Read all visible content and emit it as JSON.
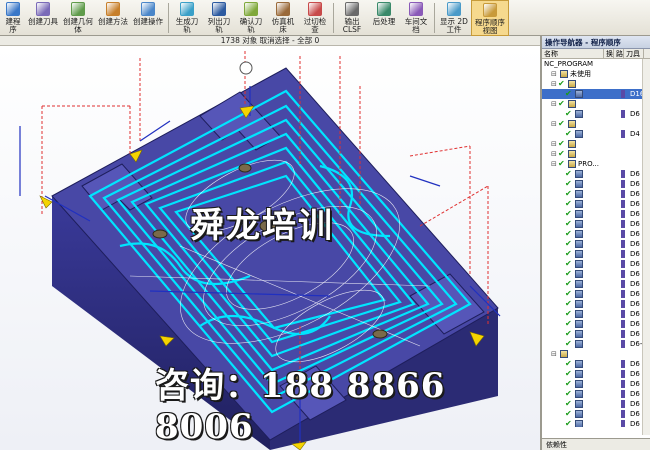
{
  "toolbar": {
    "items": [
      {
        "label": "建程序",
        "icon": "create-program-icon",
        "color": "#3a78c8"
      },
      {
        "label": "创建刀具",
        "icon": "create-tool-icon",
        "color": "#7a6ab8"
      },
      {
        "label": "创建几何体",
        "icon": "create-geometry-icon",
        "color": "#5f9b4a"
      },
      {
        "label": "创建方法",
        "icon": "create-method-icon",
        "color": "#c77f2a"
      },
      {
        "label": "创建操作",
        "icon": "create-operation-icon",
        "color": "#4a86c9"
      },
      {
        "label": "生成刀轨",
        "icon": "generate-toolpath-icon",
        "color": "#3aa0c8"
      },
      {
        "label": "列出刀轨",
        "icon": "list-toolpath-icon",
        "color": "#2c5aa0"
      },
      {
        "label": "确认刀轨",
        "icon": "verify-toolpath-icon",
        "color": "#7fa83a"
      },
      {
        "label": "仿真机床",
        "icon": "simulate-machine-icon",
        "color": "#9a6a3a"
      },
      {
        "label": "过切检查",
        "icon": "gouge-check-icon",
        "color": "#c84a4a"
      },
      {
        "label": "输出CLSF",
        "icon": "output-clsf-icon",
        "color": "#6a6a6a"
      },
      {
        "label": "后处理",
        "icon": "postprocess-icon",
        "color": "#3a8a6a"
      },
      {
        "label": "车间文档",
        "icon": "shop-doc-icon",
        "color": "#8a5ab8"
      },
      {
        "label": "显示 2D工件",
        "icon": "show-2d-workpiece-icon",
        "color": "#4a9ac8"
      },
      {
        "label": "程序顺序视图",
        "icon": "program-order-view-icon",
        "color": "#c89a3a"
      }
    ]
  },
  "status": {
    "text": "1738 对象 取消选择 - 全部 0"
  },
  "watermark": {
    "title": "舜龙培训",
    "contact": "咨询：188 8866 8006"
  },
  "navigator": {
    "title": "操作导航器 - 程序顺序",
    "columns": [
      "名称",
      "换",
      "路",
      "刀具"
    ],
    "rows": [
      {
        "text": "NC_PROGRAM",
        "indent": 0,
        "check": false,
        "type": "text",
        "tool": ""
      },
      {
        "text": "未使用",
        "indent": 1,
        "check": false,
        "type": "folder",
        "tool": ""
      },
      {
        "text": "",
        "indent": 1,
        "check": true,
        "type": "folder",
        "tool": ""
      },
      {
        "text": "",
        "indent": 2,
        "check": true,
        "type": "op",
        "tool": "D16R0.8",
        "selected": true
      },
      {
        "text": "",
        "indent": 1,
        "check": true,
        "type": "folder",
        "tool": ""
      },
      {
        "text": "",
        "indent": 2,
        "check": true,
        "type": "op",
        "tool": "D6"
      },
      {
        "text": "",
        "indent": 1,
        "check": true,
        "type": "folder",
        "tool": ""
      },
      {
        "text": "",
        "indent": 2,
        "check": true,
        "type": "op",
        "tool": "D4"
      },
      {
        "text": "",
        "indent": 1,
        "check": true,
        "type": "folder",
        "tool": ""
      },
      {
        "text": "",
        "indent": 1,
        "check": true,
        "type": "folder",
        "tool": ""
      },
      {
        "text": "PRO...",
        "indent": 1,
        "check": true,
        "type": "folder",
        "tool": ""
      },
      {
        "text": "",
        "indent": 2,
        "check": true,
        "type": "op",
        "tool": "D6"
      },
      {
        "text": "",
        "indent": 2,
        "check": true,
        "type": "op",
        "tool": "D6"
      },
      {
        "text": "",
        "indent": 2,
        "check": true,
        "type": "op",
        "tool": "D6"
      },
      {
        "text": "",
        "indent": 2,
        "check": true,
        "type": "op",
        "tool": "D6"
      },
      {
        "text": "",
        "indent": 2,
        "check": true,
        "type": "op",
        "tool": "D6"
      },
      {
        "text": "",
        "indent": 2,
        "check": true,
        "type": "op",
        "tool": "D6"
      },
      {
        "text": "",
        "indent": 2,
        "check": true,
        "type": "op",
        "tool": "D6"
      },
      {
        "text": "",
        "indent": 2,
        "check": true,
        "type": "op",
        "tool": "D6"
      },
      {
        "text": "",
        "indent": 2,
        "check": true,
        "type": "op",
        "tool": "D6"
      },
      {
        "text": "",
        "indent": 2,
        "check": true,
        "type": "op",
        "tool": "D6"
      },
      {
        "text": "",
        "indent": 2,
        "check": true,
        "type": "op",
        "tool": "D6"
      },
      {
        "text": "",
        "indent": 2,
        "check": true,
        "type": "op",
        "tool": "D6"
      },
      {
        "text": "",
        "indent": 2,
        "check": true,
        "type": "op",
        "tool": "D6"
      },
      {
        "text": "",
        "indent": 2,
        "check": true,
        "type": "op",
        "tool": "D6"
      },
      {
        "text": "",
        "indent": 2,
        "check": true,
        "type": "op",
        "tool": "D6"
      },
      {
        "text": "",
        "indent": 2,
        "check": true,
        "type": "op",
        "tool": "D6"
      },
      {
        "text": "",
        "indent": 2,
        "check": true,
        "type": "op",
        "tool": "D6"
      },
      {
        "text": "",
        "indent": 2,
        "check": true,
        "type": "op",
        "tool": "D6-0.1"
      },
      {
        "text": "",
        "indent": 1,
        "check": false,
        "type": "folder",
        "tool": ""
      },
      {
        "text": "",
        "indent": 2,
        "check": true,
        "type": "op",
        "tool": "D6"
      },
      {
        "text": "",
        "indent": 2,
        "check": true,
        "type": "op",
        "tool": "D6"
      },
      {
        "text": "",
        "indent": 2,
        "check": true,
        "type": "op",
        "tool": "D6"
      },
      {
        "text": "",
        "indent": 2,
        "check": true,
        "type": "op",
        "tool": "D6"
      },
      {
        "text": "",
        "indent": 2,
        "check": true,
        "type": "op",
        "tool": "D6"
      },
      {
        "text": "",
        "indent": 2,
        "check": true,
        "type": "op",
        "tool": "D6"
      },
      {
        "text": "",
        "indent": 2,
        "check": true,
        "type": "op",
        "tool": "D6"
      }
    ],
    "bottom_label": "依赖性"
  },
  "colors": {
    "part": "#4a4aa8",
    "part_dark": "#2e2e78",
    "toolpath": "#00e5ff",
    "toolpath_white": "#ffffff",
    "rapid": "#e03030",
    "selected_row": "#3d6fc9"
  }
}
